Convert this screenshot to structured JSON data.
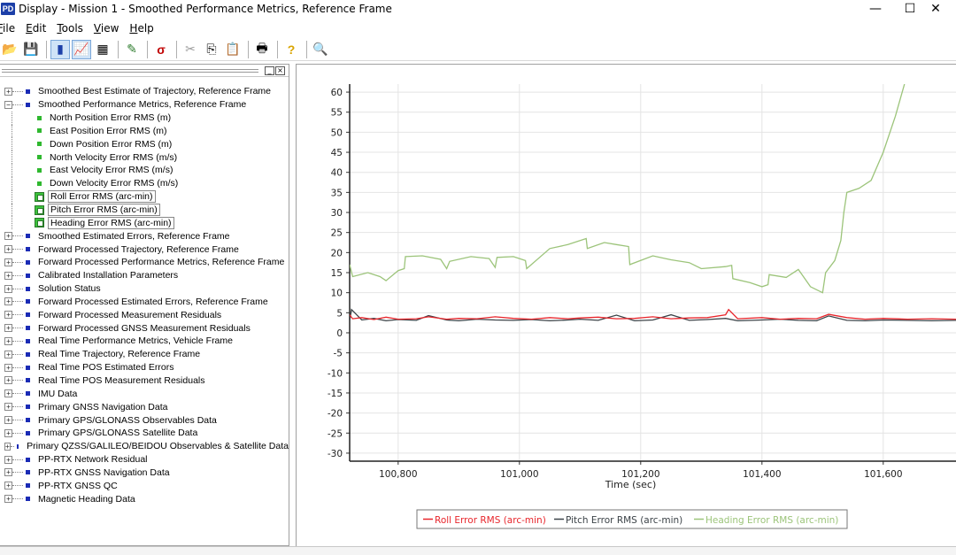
{
  "window": {
    "title": "Display - Mission 1 - Smoothed Performance Metrics, Reference Frame",
    "icon_text": "PD",
    "minimize": "—",
    "maximize": "☐",
    "close": "✕"
  },
  "menu": [
    {
      "u": "F",
      "rest": "ile"
    },
    {
      "u": "E",
      "rest": "dit"
    },
    {
      "u": "T",
      "rest": "ools"
    },
    {
      "u": "V",
      "rest": "iew"
    },
    {
      "u": "H",
      "rest": "elp"
    }
  ],
  "toolbar": {
    "icons": [
      "open-folder-icon",
      "save-icon",
      "bar-chart-icon",
      "line-chart-icon",
      "table-icon",
      "pencil-icon",
      "sigma-icon",
      "cut-icon",
      "copy-icon",
      "paste-icon",
      "print-icon",
      "help-icon",
      "zoom-icon"
    ],
    "glyphs": [
      "📂",
      "💾",
      "▮",
      "📈",
      "▦",
      "✎",
      "σ",
      "✂",
      "⎘",
      "📋",
      "🖶",
      "?",
      "🔍"
    ]
  },
  "tree_header": {
    "min": "_",
    "close": "×"
  },
  "tree": [
    {
      "label": "Smoothed Best Estimate of Trajectory, Reference Frame",
      "expander": "+",
      "level": 0
    },
    {
      "label": "Smoothed Performance Metrics, Reference Frame",
      "expander": "−",
      "level": 0
    },
    {
      "label": "North Position Error RMS (m)",
      "level": 1,
      "marker": "green"
    },
    {
      "label": "East Position Error RMS (m)",
      "level": 1,
      "marker": "green"
    },
    {
      "label": "Down Position Error RMS (m)",
      "level": 1,
      "marker": "green"
    },
    {
      "label": "North Velocity Error RMS (m/s)",
      "level": 1,
      "marker": "green"
    },
    {
      "label": "East Velocity Error RMS (m/s)",
      "level": 1,
      "marker": "green"
    },
    {
      "label": "Down Velocity Error RMS (m/s)",
      "level": 1,
      "marker": "green"
    },
    {
      "label": "Roll Error RMS (arc-min)",
      "level": 1,
      "marker": "checked"
    },
    {
      "label": "Pitch Error RMS (arc-min)",
      "level": 1,
      "marker": "checked"
    },
    {
      "label": "Heading Error RMS (arc-min)",
      "level": 1,
      "marker": "checked"
    },
    {
      "label": "Smoothed Estimated Errors, Reference Frame",
      "expander": "+",
      "level": 0
    },
    {
      "label": "Forward Processed Trajectory, Reference Frame",
      "expander": "+",
      "level": 0
    },
    {
      "label": "Forward Processed Performance Metrics, Reference Frame",
      "expander": "+",
      "level": 0
    },
    {
      "label": "Calibrated Installation Parameters",
      "expander": "+",
      "level": 0
    },
    {
      "label": "Solution Status",
      "expander": "+",
      "level": 0
    },
    {
      "label": "Forward Processed Estimated Errors, Reference Frame",
      "expander": "+",
      "level": 0
    },
    {
      "label": "Forward Processed Measurement Residuals",
      "expander": "+",
      "level": 0
    },
    {
      "label": "Forward Processed GNSS Measurement Residuals",
      "expander": "+",
      "level": 0
    },
    {
      "label": "Real Time Performance Metrics, Vehicle Frame",
      "expander": "+",
      "level": 0
    },
    {
      "label": "Real Time Trajectory, Reference Frame",
      "expander": "+",
      "level": 0
    },
    {
      "label": "Real Time POS Estimated Errors",
      "expander": "+",
      "level": 0
    },
    {
      "label": "Real Time POS Measurement Residuals",
      "expander": "+",
      "level": 0
    },
    {
      "label": "IMU Data",
      "expander": "+",
      "level": 0
    },
    {
      "label": "Primary GNSS Navigation Data",
      "expander": "+",
      "level": 0
    },
    {
      "label": "Primary GPS/GLONASS Observables Data",
      "expander": "+",
      "level": 0
    },
    {
      "label": "Primary GPS/GLONASS Satellite Data",
      "expander": "+",
      "level": 0
    },
    {
      "label": "Primary QZSS/GALILEO/BEIDOU Observables & Satellite Data",
      "expander": "+",
      "level": 0
    },
    {
      "label": "PP-RTX Network Residual",
      "expander": "+",
      "level": 0
    },
    {
      "label": "PP-RTX GNSS Navigation Data",
      "expander": "+",
      "level": 0
    },
    {
      "label": "PP-RTX GNSS QC",
      "expander": "+",
      "level": 0
    },
    {
      "label": "Magnetic Heading Data",
      "expander": "+",
      "level": 0
    }
  ],
  "chart_data": {
    "type": "line",
    "xlabel": "Time (sec)",
    "ylabel": "",
    "xlim": [
      100720,
      101720
    ],
    "ylim": [
      -32,
      62
    ],
    "xticks": [
      100800,
      101000,
      101200,
      101400,
      101600
    ],
    "xtick_labels": [
      "100,800",
      "101,000",
      "101,200",
      "101,400",
      "101,600"
    ],
    "yticks": [
      60,
      55,
      50,
      45,
      40,
      35,
      30,
      25,
      20,
      15,
      10,
      5,
      0,
      -5,
      -10,
      -15,
      -20,
      -25,
      -30
    ],
    "grid": true,
    "legend_position": "bottom-center",
    "series": [
      {
        "name": "Roll Error RMS (arc-min)",
        "color": "#e8262c",
        "x": [
          100720,
          100725,
          100740,
          100760,
          100780,
          100800,
          100830,
          100850,
          100880,
          100900,
          100930,
          100960,
          100990,
          101020,
          101050,
          101080,
          101100,
          101130,
          101160,
          101190,
          101220,
          101250,
          101280,
          101310,
          101340,
          101345,
          101360,
          101400,
          101430,
          101460,
          101490,
          101510,
          101540,
          101570,
          101600,
          101640,
          101680,
          101720
        ],
        "y": [
          4.5,
          3.5,
          3.8,
          3.3,
          3.9,
          3.4,
          3.5,
          4.0,
          3.4,
          3.6,
          3.5,
          4.0,
          3.6,
          3.4,
          3.8,
          3.5,
          3.7,
          3.9,
          3.5,
          3.6,
          4.0,
          3.5,
          3.7,
          3.8,
          4.5,
          5.8,
          3.5,
          3.8,
          3.4,
          3.6,
          3.5,
          4.6,
          3.8,
          3.4,
          3.6,
          3.4,
          3.5,
          3.4
        ]
      },
      {
        "name": "Pitch Error RMS (arc-min)",
        "color": "#3c4348",
        "x": [
          100720,
          100723,
          100740,
          100760,
          100780,
          100800,
          100830,
          100850,
          100880,
          100900,
          100930,
          100960,
          100990,
          101020,
          101050,
          101080,
          101100,
          101130,
          101160,
          101190,
          101220,
          101250,
          101280,
          101310,
          101340,
          101360,
          101400,
          101430,
          101460,
          101490,
          101510,
          101540,
          101570,
          101600,
          101640,
          101680,
          101720
        ],
        "y": [
          3.0,
          5.8,
          3.2,
          3.6,
          3.0,
          3.3,
          3.1,
          4.3,
          3.2,
          3.0,
          3.4,
          3.2,
          3.1,
          3.3,
          3.0,
          3.2,
          3.4,
          3.1,
          4.4,
          3.0,
          3.2,
          4.5,
          3.1,
          3.3,
          3.6,
          3.0,
          3.2,
          3.4,
          3.1,
          3.0,
          4.2,
          3.1,
          3.0,
          3.2,
          3.1,
          3.0,
          3.1
        ]
      },
      {
        "name": "Heading Error RMS (arc-min)",
        "color": "#9cc47a",
        "x": [
          100720,
          100725,
          100750,
          100770,
          100780,
          100800,
          100810,
          100812,
          100840,
          100870,
          100880,
          100885,
          100920,
          100950,
          100960,
          100963,
          100990,
          101010,
          101012,
          101050,
          101080,
          101110,
          101112,
          101140,
          101160,
          101180,
          101182,
          101220,
          101250,
          101280,
          101300,
          101340,
          101350,
          101352,
          101380,
          101400,
          101410,
          101412,
          101440,
          101460,
          101480,
          101500,
          101505,
          101520,
          101530,
          101535,
          101540,
          101560,
          101580,
          101600,
          101620,
          101635
        ],
        "y": [
          17.0,
          14.0,
          15.0,
          14.0,
          13.0,
          15.5,
          16.0,
          19.0,
          19.2,
          18.3,
          16.0,
          17.8,
          19.0,
          18.5,
          16.3,
          18.8,
          19.0,
          18.0,
          16.0,
          21.0,
          22.0,
          23.5,
          21.0,
          22.5,
          22.0,
          21.5,
          17.0,
          19.2,
          18.2,
          17.5,
          16.0,
          16.5,
          16.8,
          13.5,
          12.5,
          11.5,
          12.0,
          14.5,
          13.8,
          15.8,
          11.5,
          10.0,
          15.0,
          18.0,
          23.0,
          30.0,
          35.0,
          36.0,
          38.0,
          45.0,
          54.0,
          62.0
        ]
      }
    ]
  }
}
